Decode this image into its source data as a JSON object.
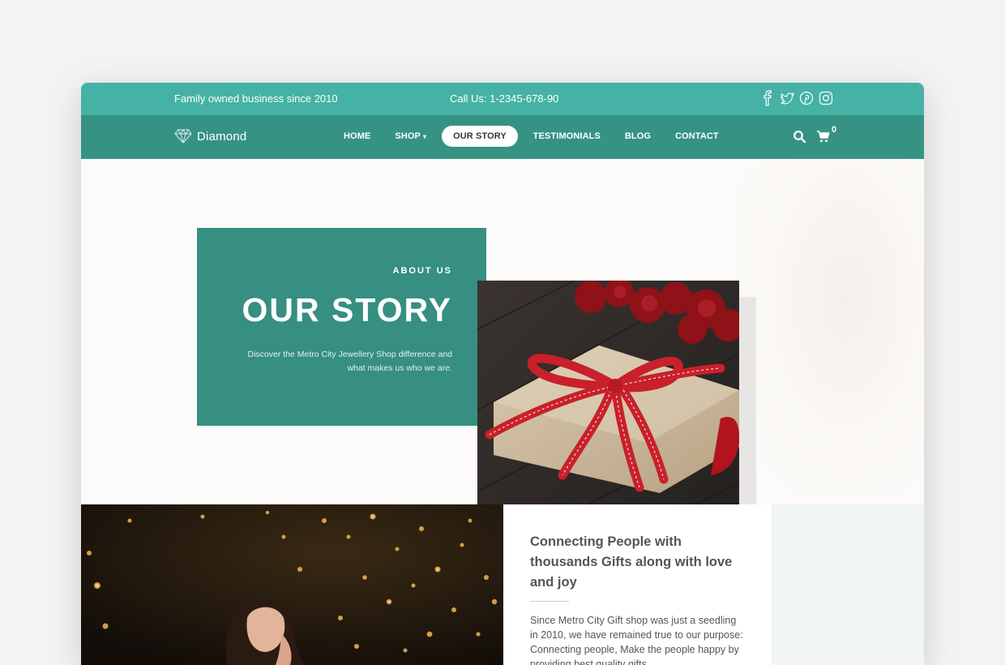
{
  "topbar": {
    "tagline": "Family owned business since 2010",
    "phone": "Call Us: 1-2345-678-90",
    "social": [
      "facebook-icon",
      "twitter-icon",
      "pinterest-icon",
      "instagram-icon"
    ],
    "background": "#45b2a5"
  },
  "navbar": {
    "logo_text": "Diamond",
    "menu": [
      {
        "label": "HOME",
        "active": false
      },
      {
        "label": "SHOP",
        "active": false,
        "has_dropdown": true
      },
      {
        "label": "OUR STORY",
        "active": true
      },
      {
        "label": "TESTIMONIALS",
        "active": false
      },
      {
        "label": "BLOG",
        "active": false
      },
      {
        "label": "CONTACT",
        "active": false
      }
    ],
    "cart_count": "0",
    "background": "#369384"
  },
  "hero": {
    "eyebrow": "ABOUT US",
    "title": "OUR STORY",
    "description": "Discover the Metro City Jewellery Shop difference and what makes us who we are.",
    "card_color": "#368f81"
  },
  "about": {
    "heading": "Connecting People with thousands Gifts along with love and joy",
    "body": "Since Metro City Gift shop was just a seedling in 2010, we have remained true to our purpose: Connecting people, Make the people happy by providing best quality gifts"
  }
}
